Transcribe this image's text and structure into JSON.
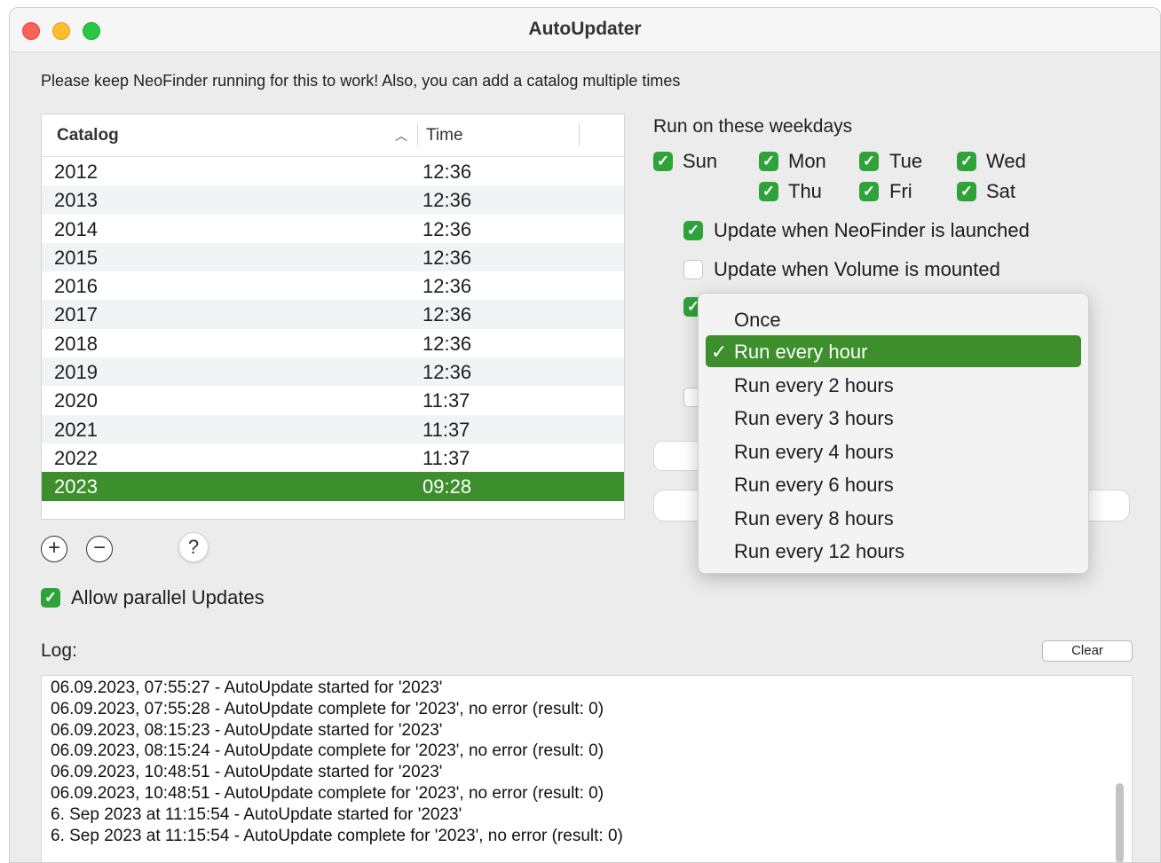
{
  "window": {
    "title": "AutoUpdater"
  },
  "info_text": "Please keep NeoFinder running for this to work! Also, you can add a catalog multiple times",
  "table": {
    "headers": {
      "catalog": "Catalog",
      "time": "Time",
      "sort_indicator": "^"
    },
    "rows": [
      {
        "catalog": "2012",
        "time": "12:36"
      },
      {
        "catalog": "2013",
        "time": "12:36"
      },
      {
        "catalog": "2014",
        "time": "12:36"
      },
      {
        "catalog": "2015",
        "time": "12:36"
      },
      {
        "catalog": "2016",
        "time": "12:36"
      },
      {
        "catalog": "2017",
        "time": "12:36"
      },
      {
        "catalog": "2018",
        "time": "12:36"
      },
      {
        "catalog": "2019",
        "time": "12:36"
      },
      {
        "catalog": "2020",
        "time": "11:37"
      },
      {
        "catalog": "2021",
        "time": "11:37"
      },
      {
        "catalog": "2022",
        "time": "11:37"
      },
      {
        "catalog": "2023",
        "time": "09:28",
        "selected": true
      }
    ]
  },
  "buttons": {
    "add": "+",
    "remove": "−",
    "help": "?",
    "clear": "Clear"
  },
  "allow_parallel": {
    "label": "Allow parallel Updates",
    "checked": true
  },
  "weekdays": {
    "heading": "Run on these weekdays",
    "days": [
      {
        "label": "Sun",
        "checked": true
      },
      {
        "label": "Mon",
        "checked": true
      },
      {
        "label": "Tue",
        "checked": true
      },
      {
        "label": "Wed",
        "checked": true
      },
      {
        "label": "Thu",
        "checked": true
      },
      {
        "label": "Fri",
        "checked": true
      },
      {
        "label": "Sat",
        "checked": true
      }
    ]
  },
  "options": {
    "update_on_launch": {
      "label": "Update when NeoFinder is launched",
      "checked": true
    },
    "update_on_mount": {
      "label": "Update when Volume is mounted",
      "checked": false
    }
  },
  "schedule_menu": {
    "items": [
      "Once",
      "Run every hour",
      "Run every 2 hours",
      "Run every 3 hours",
      "Run every 4 hours",
      "Run every 6 hours",
      "Run every 8 hours",
      "Run every 12 hours"
    ],
    "selected": "Run every hour",
    "check_glyph": "✓"
  },
  "log": {
    "label": "Log:",
    "lines": [
      "06.09.2023, 07:55:27 - AutoUpdate started for '2023'",
      "06.09.2023, 07:55:28 - AutoUpdate complete for '2023', no error (result: 0)",
      "06.09.2023, 08:15:23 - AutoUpdate started for '2023'",
      "06.09.2023, 08:15:24 - AutoUpdate complete for '2023', no error (result: 0)",
      "06.09.2023, 10:48:51 - AutoUpdate started for '2023'",
      "06.09.2023, 10:48:51 - AutoUpdate complete for '2023', no error (result: 0)",
      "6. Sep 2023 at 11:15:54 - AutoUpdate started for '2023'",
      "6. Sep 2023 at 11:15:54 - AutoUpdate complete for '2023', no error (result: 0)"
    ]
  },
  "colors": {
    "selection": "#3d8f2c",
    "checkbox_on": "#2fa33a",
    "close": "#fe5f57",
    "minimize": "#febc2e",
    "zoom": "#28c840"
  }
}
